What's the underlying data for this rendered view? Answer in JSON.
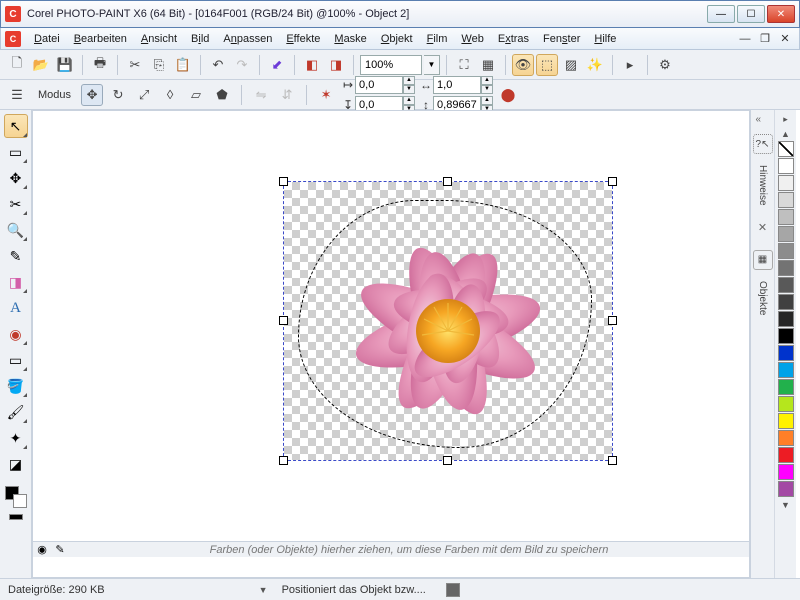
{
  "window": {
    "title": "Corel PHOTO-PAINT X6 (64 Bit) - [0164F001 (RGB/24 Bit) @100% - Object 2]"
  },
  "menu": {
    "items": [
      "Datei",
      "Bearbeiten",
      "Ansicht",
      "Bild",
      "Anpassen",
      "Effekte",
      "Maske",
      "Objekt",
      "Film",
      "Web",
      "Extras",
      "Fenster",
      "Hilfe"
    ]
  },
  "toolbar1": {
    "zoom": "100%"
  },
  "propbar": {
    "modus_label": "Modus",
    "pos_x": "0,0",
    "pos_y": "0,0",
    "scale_x": "1,0",
    "scale_y": "0,89667"
  },
  "canvas": {
    "drop_hint": "Farben (oder Objekte) hierher ziehen, um diese Farben mit dem Bild zu speichern"
  },
  "dockers": {
    "hinweise": "Hinweise",
    "objekte": "Objekte"
  },
  "palette": {
    "colors": [
      "#ffffff",
      "#f0f0f0",
      "#d9d9d9",
      "#bfbfbf",
      "#a6a6a6",
      "#8c8c8c",
      "#737373",
      "#595959",
      "#404040",
      "#262626",
      "#000000",
      "#0033cc",
      "#00a2e8",
      "#22b14c",
      "#b5e61d",
      "#fff200",
      "#ff7f27",
      "#ed1c24",
      "#ff00ff",
      "#a349a4"
    ]
  },
  "status": {
    "filesize_label": "Dateigröße:",
    "filesize_value": "290 KB",
    "hint": "Positioniert das Objekt bzw...."
  }
}
